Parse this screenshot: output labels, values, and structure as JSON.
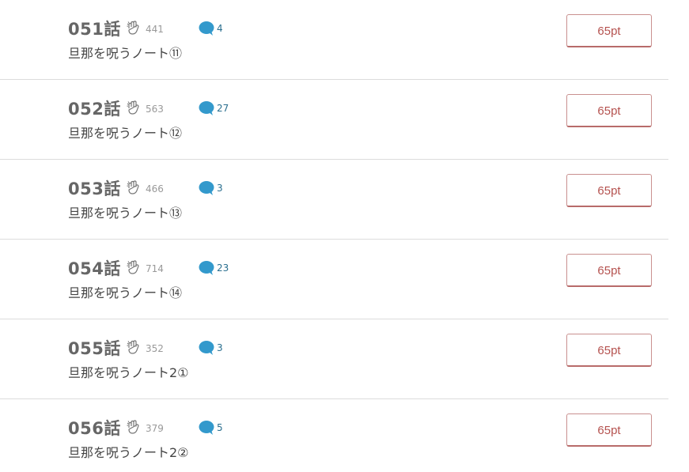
{
  "episodes": [
    {
      "number": "051話",
      "clap_count": "441",
      "comment_count": "4",
      "title": "旦那を呪うノート⑪",
      "price": "65pt"
    },
    {
      "number": "052話",
      "clap_count": "563",
      "comment_count": "27",
      "title": "旦那を呪うノート⑫",
      "price": "65pt"
    },
    {
      "number": "053話",
      "clap_count": "466",
      "comment_count": "3",
      "title": "旦那を呪うノート⑬",
      "price": "65pt"
    },
    {
      "number": "054話",
      "clap_count": "714",
      "comment_count": "23",
      "title": "旦那を呪うノート⑭",
      "price": "65pt"
    },
    {
      "number": "055話",
      "clap_count": "352",
      "comment_count": "3",
      "title": "旦那を呪うノート2①",
      "price": "65pt"
    },
    {
      "number": "056話",
      "clap_count": "379",
      "comment_count": "5",
      "title": "旦那を呪うノート2②",
      "price": "65pt"
    }
  ],
  "icons": {
    "clap": "clap-icon",
    "comment": "comment-bubble-icon"
  },
  "colors": {
    "comment_bubble": "#3399cc",
    "price_text": "#b5524f",
    "price_border": "#c9908f"
  }
}
